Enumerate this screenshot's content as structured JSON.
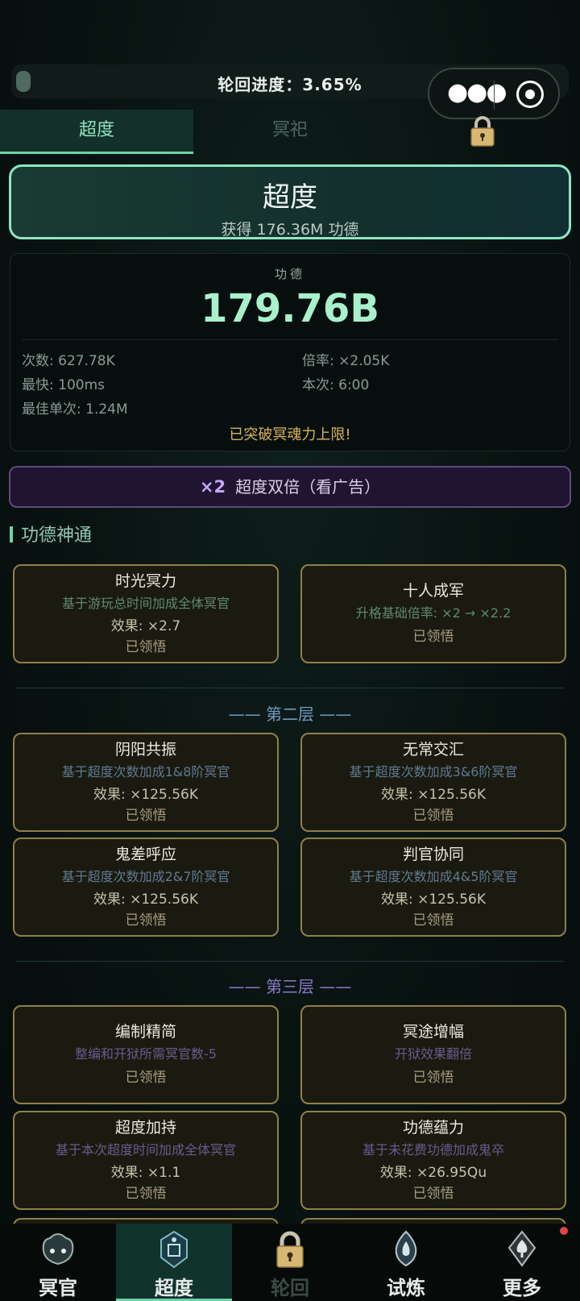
{
  "progress": {
    "label": "轮回进度：3.65%",
    "value_percent": 3.65
  },
  "tabs": [
    {
      "label": "超度",
      "active": true
    },
    {
      "label": "冥祀",
      "active": false
    },
    {
      "label": "",
      "locked": true
    }
  ],
  "banner": {
    "title": "超度",
    "subtitle": "获得 176.36M 功德"
  },
  "stats": {
    "label": "功德",
    "value": "179.76B",
    "count": "次数: 627.78K",
    "rate": "倍率: ×2.05K",
    "fastest": "最快: 100ms",
    "current": "本次: 6:00",
    "best_single": "最佳单次: 1.24M",
    "warning": "已突破冥魂力上限!"
  },
  "ad_button": {
    "multiplier": "×2",
    "label": "超度双倍（看广告）"
  },
  "section_title": "功德神通",
  "layer1": [
    {
      "name": "时光冥力",
      "desc": "基于游玩总时间加成全体冥官",
      "effect": "效果: ×2.7",
      "status": "已领悟"
    },
    {
      "name": "十人成军",
      "desc": "升格基础倍率: ×2 → ×2.2",
      "effect": "",
      "status": "已领悟"
    }
  ],
  "layer2_title": "—— 第二层 ——",
  "layer2": [
    {
      "name": "阴阳共振",
      "desc": "基于超度次数加成1&8阶冥官",
      "effect": "效果: ×125.56K",
      "status": "已领悟"
    },
    {
      "name": "无常交汇",
      "desc": "基于超度次数加成3&6阶冥官",
      "effect": "效果: ×125.56K",
      "status": "已领悟"
    },
    {
      "name": "鬼差呼应",
      "desc": "基于超度次数加成2&7阶冥官",
      "effect": "效果: ×125.56K",
      "status": "已领悟"
    },
    {
      "name": "判官协同",
      "desc": "基于超度次数加成4&5阶冥官",
      "effect": "效果: ×125.56K",
      "status": "已领悟"
    }
  ],
  "layer3_title": "—— 第三层 ——",
  "layer3": [
    {
      "name": "编制精简",
      "desc": "整编和开狱所需冥官数-5",
      "effect": "",
      "status": "已领悟"
    },
    {
      "name": "冥途增幅",
      "desc": "开狱效果翻倍",
      "effect": "",
      "status": "已领悟"
    },
    {
      "name": "超度加持",
      "desc": "基于本次超度时间加成全体冥官",
      "effect": "效果: ×1.1",
      "status": "已领悟"
    },
    {
      "name": "功德蕴力",
      "desc": "基于未花费功德加成鬼卒",
      "effect": "效果: ×26.95Qu",
      "status": "已领悟"
    }
  ],
  "nav": [
    {
      "label": "冥官",
      "icon": "ghost-mask-icon"
    },
    {
      "label": "超度",
      "icon": "altar-icon",
      "active": true
    },
    {
      "label": "轮回",
      "icon": "lock-icon",
      "locked": true
    },
    {
      "label": "试炼",
      "icon": "flame-shield-icon"
    },
    {
      "label": "更多",
      "icon": "spade-emblem-icon"
    }
  ]
}
